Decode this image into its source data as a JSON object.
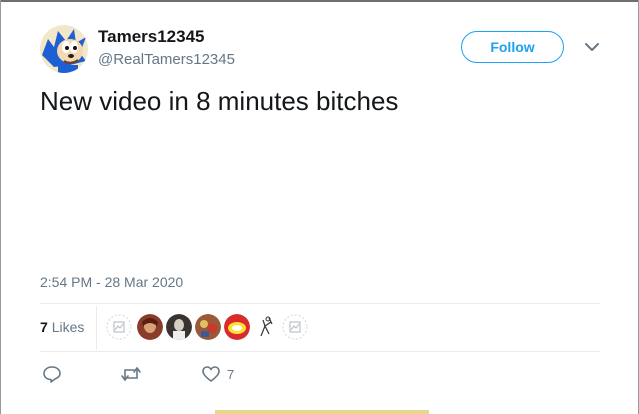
{
  "tweet": {
    "display_name": "Tamers12345",
    "handle": "@RealTamers12345",
    "follow_label": "Follow",
    "text": "New video in 8 minutes bitches",
    "timestamp": "2:54 PM - 28 Mar 2020",
    "likes_count": "7",
    "likes_label": "Likes"
  },
  "likers": [
    {
      "name": "liker-1",
      "kind": "default"
    },
    {
      "name": "liker-2",
      "kind": "photo",
      "color": "#8a3b2a"
    },
    {
      "name": "liker-3",
      "kind": "photo",
      "color": "#3a3430"
    },
    {
      "name": "liker-4",
      "kind": "photo",
      "color": "#9a5a3a"
    },
    {
      "name": "liker-5",
      "kind": "photo",
      "color": "#d92b2b"
    },
    {
      "name": "liker-6",
      "kind": "sketch"
    },
    {
      "name": "liker-7",
      "kind": "default"
    }
  ],
  "actions": {
    "reply_icon": "reply-icon",
    "retweet_icon": "retweet-icon",
    "like_icon": "heart-icon",
    "like_count": "7"
  },
  "colors": {
    "accent": "#1da1f2",
    "secondary_text": "#657786",
    "primary_text": "#14171a",
    "divider": "#e6ecf0"
  }
}
